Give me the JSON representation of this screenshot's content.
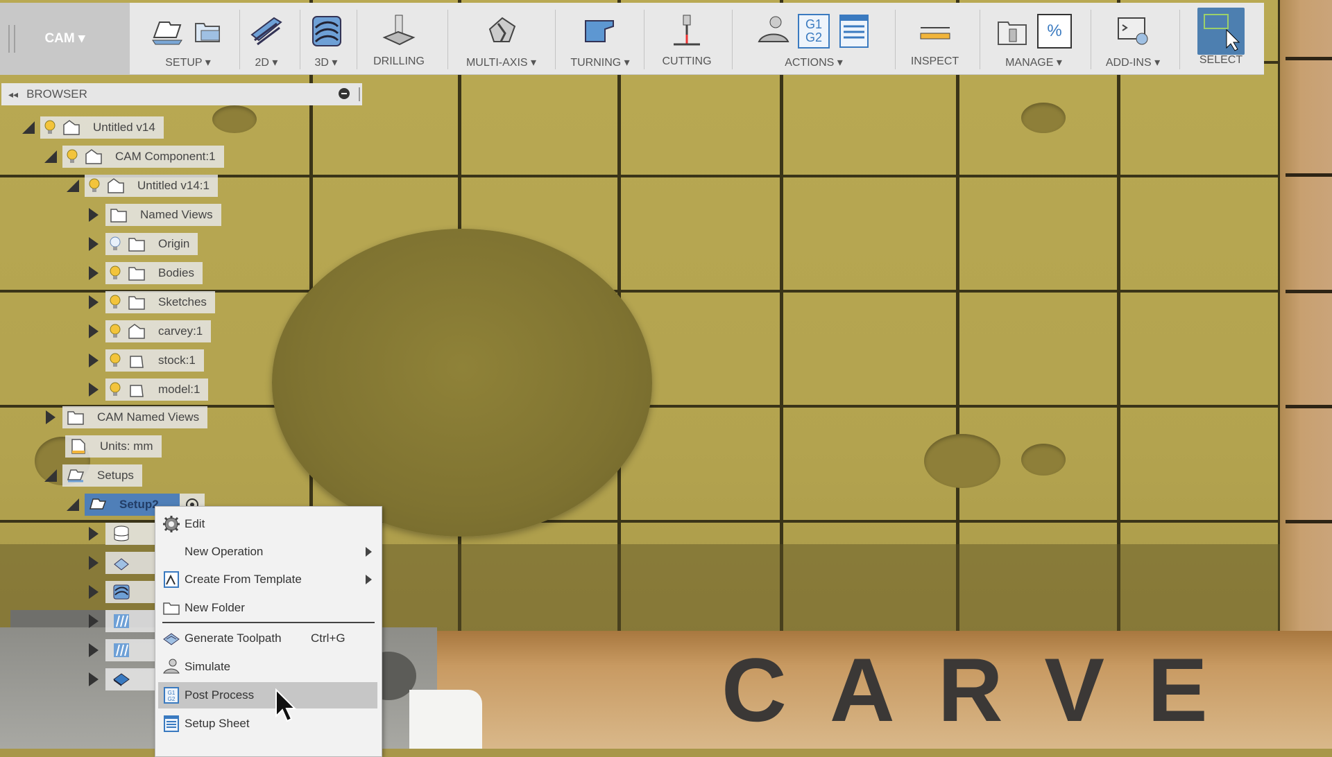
{
  "workspace": {
    "label": "CAM ▾"
  },
  "toolbar": {
    "groups": [
      {
        "label": "SETUP ▾"
      },
      {
        "label": "2D ▾"
      },
      {
        "label": "3D ▾"
      },
      {
        "label": "DRILLING"
      },
      {
        "label": "MULTI-AXIS ▾"
      },
      {
        "label": "TURNING ▾"
      },
      {
        "label": "CUTTING"
      },
      {
        "label": "ACTIONS ▾"
      },
      {
        "label": "INSPECT"
      },
      {
        "label": "MANAGE ▾"
      },
      {
        "label": "ADD-INS ▾"
      },
      {
        "label": "SELECT"
      }
    ],
    "g1g2_text": [
      "G1",
      "G2"
    ],
    "percent_text": "%"
  },
  "browser": {
    "title": "BROWSER",
    "nodes": [
      {
        "label": "Untitled v14"
      },
      {
        "label": "CAM Component:1"
      },
      {
        "label": "Untitled v14:1"
      },
      {
        "label": "Named Views"
      },
      {
        "label": "Origin"
      },
      {
        "label": "Bodies"
      },
      {
        "label": "Sketches"
      },
      {
        "label": "carvey:1"
      },
      {
        "label": "stock:1"
      },
      {
        "label": "model:1"
      },
      {
        "label": "CAM Named Views"
      },
      {
        "label": "Units: mm"
      },
      {
        "label": "Setups"
      },
      {
        "label": "Setup2"
      }
    ]
  },
  "context_menu": {
    "items": [
      {
        "label": "Edit",
        "icon": "gear-icon"
      },
      {
        "label": "New Operation",
        "submenu": true
      },
      {
        "label": "Create From Template",
        "icon": "template-icon",
        "submenu": true
      },
      {
        "label": "New Folder",
        "icon": "folder-icon"
      },
      {
        "label": "Generate Toolpath",
        "icon": "generate-icon",
        "shortcut": "Ctrl+G"
      },
      {
        "label": "Simulate",
        "icon": "simulate-icon"
      },
      {
        "label": "Post Process",
        "icon": "post-process-icon",
        "highlighted": true
      },
      {
        "label": "Setup Sheet",
        "icon": "setup-sheet-icon"
      }
    ]
  },
  "scene": {
    "logo_text": "CARVE"
  },
  "colors": {
    "accent": "#4f7fb8",
    "toolbar_bg": "#e8e8e8",
    "viewport": "#b3a34f"
  }
}
